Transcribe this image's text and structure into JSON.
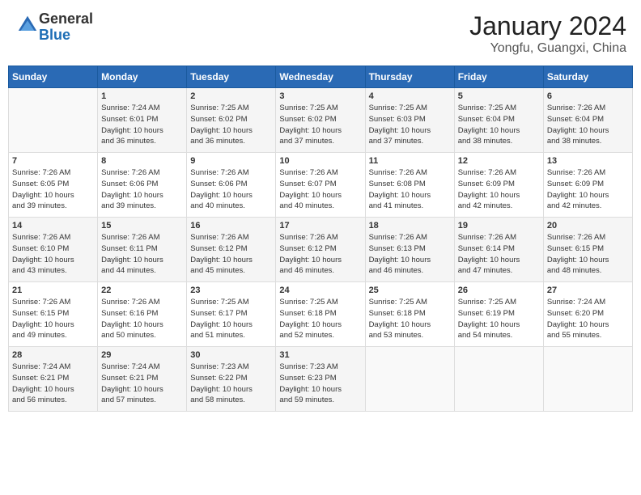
{
  "header": {
    "logo_general": "General",
    "logo_blue": "Blue",
    "month_year": "January 2024",
    "location": "Yongfu, Guangxi, China"
  },
  "days_of_week": [
    "Sunday",
    "Monday",
    "Tuesday",
    "Wednesday",
    "Thursday",
    "Friday",
    "Saturday"
  ],
  "weeks": [
    [
      {
        "day": "",
        "info": ""
      },
      {
        "day": "1",
        "info": "Sunrise: 7:24 AM\nSunset: 6:01 PM\nDaylight: 10 hours\nand 36 minutes."
      },
      {
        "day": "2",
        "info": "Sunrise: 7:25 AM\nSunset: 6:02 PM\nDaylight: 10 hours\nand 36 minutes."
      },
      {
        "day": "3",
        "info": "Sunrise: 7:25 AM\nSunset: 6:02 PM\nDaylight: 10 hours\nand 37 minutes."
      },
      {
        "day": "4",
        "info": "Sunrise: 7:25 AM\nSunset: 6:03 PM\nDaylight: 10 hours\nand 37 minutes."
      },
      {
        "day": "5",
        "info": "Sunrise: 7:25 AM\nSunset: 6:04 PM\nDaylight: 10 hours\nand 38 minutes."
      },
      {
        "day": "6",
        "info": "Sunrise: 7:26 AM\nSunset: 6:04 PM\nDaylight: 10 hours\nand 38 minutes."
      }
    ],
    [
      {
        "day": "7",
        "info": "Sunrise: 7:26 AM\nSunset: 6:05 PM\nDaylight: 10 hours\nand 39 minutes."
      },
      {
        "day": "8",
        "info": "Sunrise: 7:26 AM\nSunset: 6:06 PM\nDaylight: 10 hours\nand 39 minutes."
      },
      {
        "day": "9",
        "info": "Sunrise: 7:26 AM\nSunset: 6:06 PM\nDaylight: 10 hours\nand 40 minutes."
      },
      {
        "day": "10",
        "info": "Sunrise: 7:26 AM\nSunset: 6:07 PM\nDaylight: 10 hours\nand 40 minutes."
      },
      {
        "day": "11",
        "info": "Sunrise: 7:26 AM\nSunset: 6:08 PM\nDaylight: 10 hours\nand 41 minutes."
      },
      {
        "day": "12",
        "info": "Sunrise: 7:26 AM\nSunset: 6:09 PM\nDaylight: 10 hours\nand 42 minutes."
      },
      {
        "day": "13",
        "info": "Sunrise: 7:26 AM\nSunset: 6:09 PM\nDaylight: 10 hours\nand 42 minutes."
      }
    ],
    [
      {
        "day": "14",
        "info": "Sunrise: 7:26 AM\nSunset: 6:10 PM\nDaylight: 10 hours\nand 43 minutes."
      },
      {
        "day": "15",
        "info": "Sunrise: 7:26 AM\nSunset: 6:11 PM\nDaylight: 10 hours\nand 44 minutes."
      },
      {
        "day": "16",
        "info": "Sunrise: 7:26 AM\nSunset: 6:12 PM\nDaylight: 10 hours\nand 45 minutes."
      },
      {
        "day": "17",
        "info": "Sunrise: 7:26 AM\nSunset: 6:12 PM\nDaylight: 10 hours\nand 46 minutes."
      },
      {
        "day": "18",
        "info": "Sunrise: 7:26 AM\nSunset: 6:13 PM\nDaylight: 10 hours\nand 46 minutes."
      },
      {
        "day": "19",
        "info": "Sunrise: 7:26 AM\nSunset: 6:14 PM\nDaylight: 10 hours\nand 47 minutes."
      },
      {
        "day": "20",
        "info": "Sunrise: 7:26 AM\nSunset: 6:15 PM\nDaylight: 10 hours\nand 48 minutes."
      }
    ],
    [
      {
        "day": "21",
        "info": "Sunrise: 7:26 AM\nSunset: 6:15 PM\nDaylight: 10 hours\nand 49 minutes."
      },
      {
        "day": "22",
        "info": "Sunrise: 7:26 AM\nSunset: 6:16 PM\nDaylight: 10 hours\nand 50 minutes."
      },
      {
        "day": "23",
        "info": "Sunrise: 7:25 AM\nSunset: 6:17 PM\nDaylight: 10 hours\nand 51 minutes."
      },
      {
        "day": "24",
        "info": "Sunrise: 7:25 AM\nSunset: 6:18 PM\nDaylight: 10 hours\nand 52 minutes."
      },
      {
        "day": "25",
        "info": "Sunrise: 7:25 AM\nSunset: 6:18 PM\nDaylight: 10 hours\nand 53 minutes."
      },
      {
        "day": "26",
        "info": "Sunrise: 7:25 AM\nSunset: 6:19 PM\nDaylight: 10 hours\nand 54 minutes."
      },
      {
        "day": "27",
        "info": "Sunrise: 7:24 AM\nSunset: 6:20 PM\nDaylight: 10 hours\nand 55 minutes."
      }
    ],
    [
      {
        "day": "28",
        "info": "Sunrise: 7:24 AM\nSunset: 6:21 PM\nDaylight: 10 hours\nand 56 minutes."
      },
      {
        "day": "29",
        "info": "Sunrise: 7:24 AM\nSunset: 6:21 PM\nDaylight: 10 hours\nand 57 minutes."
      },
      {
        "day": "30",
        "info": "Sunrise: 7:23 AM\nSunset: 6:22 PM\nDaylight: 10 hours\nand 58 minutes."
      },
      {
        "day": "31",
        "info": "Sunrise: 7:23 AM\nSunset: 6:23 PM\nDaylight: 10 hours\nand 59 minutes."
      },
      {
        "day": "",
        "info": ""
      },
      {
        "day": "",
        "info": ""
      },
      {
        "day": "",
        "info": ""
      }
    ]
  ]
}
